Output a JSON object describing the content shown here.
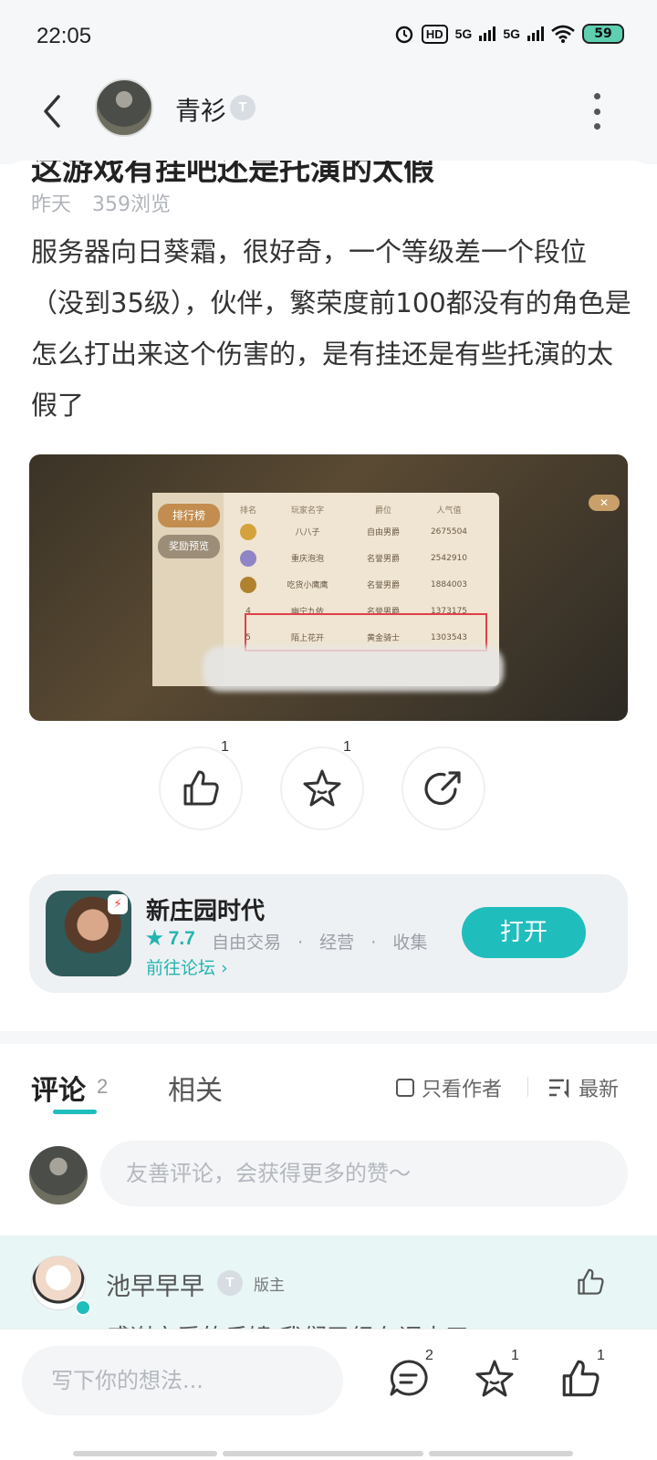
{
  "status_bar": {
    "time": "22:05",
    "net1": "5G",
    "net2": "5G",
    "hd": "HD",
    "battery": "59"
  },
  "header": {
    "author_name": "青衫",
    "author_badge": "T"
  },
  "post": {
    "title_partial": "这游戏有挂吧还是托演的太假",
    "date": "昨天",
    "views": "359浏览",
    "body": "服务器向日葵霜，很好奇，一个等级差一个段位（没到35级），伙伴，繁荣度前100都没有的角色是怎么打出来这个伤害的，是有挂还是有些托演的太假了",
    "image": {
      "tab_rank": "排行榜",
      "tab_reward": "奖励预览",
      "headers": [
        "排名",
        "玩家名字",
        "爵位",
        "人气值"
      ],
      "rows": [
        {
          "rank": "1",
          "name": "八八子",
          "title": "自由男爵",
          "value": "2675504"
        },
        {
          "rank": "2",
          "name": "重庆泡泡",
          "title": "名誉男爵",
          "value": "2542910"
        },
        {
          "rank": "3",
          "name": "吃货小鹰鹰",
          "title": "名誉男爵",
          "value": "1884003"
        },
        {
          "rank": "4",
          "name": "幽宁九依",
          "title": "名誉男爵",
          "value": "1373175"
        },
        {
          "rank": "5",
          "name": "陌上花开",
          "title": "黄金骑士",
          "value": "1303543"
        }
      ]
    }
  },
  "actions": {
    "like_count": "1",
    "favorite_count": "1"
  },
  "app_card": {
    "name": "新庄园时代",
    "rating": "7.7",
    "tags": [
      "自由交易",
      "·",
      "经营",
      "·",
      "收集"
    ],
    "forum_link": "前往论坛",
    "open_label": "打开"
  },
  "comments_tabs": {
    "comment_label": "评论",
    "comment_count": "2",
    "related_label": "相关",
    "only_author": "只看作者",
    "sort_label": "最新"
  },
  "comment_input": {
    "placeholder": "友善评论，会获得更多的赞～"
  },
  "first_comment": {
    "name": "池早早早",
    "badge": "T",
    "role": "版主",
    "text_peek": "感谢亲爱的反馈 我们已经在调查了"
  },
  "bottom_bar": {
    "placeholder": "写下你的想法...",
    "comment_count": "2",
    "favorite_count": "1",
    "like_count": "1"
  },
  "colors": {
    "accent": "#20bdbd",
    "highlight_box": "#e0404a"
  }
}
